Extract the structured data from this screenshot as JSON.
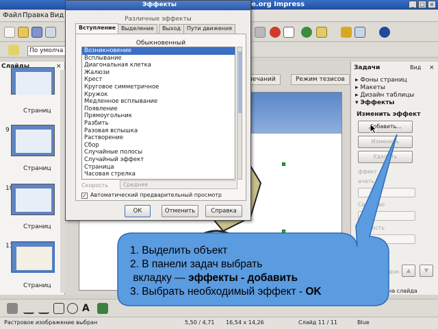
{
  "window": {
    "title": "ffice.org Impress",
    "controls": [
      "_",
      "□",
      "×"
    ]
  },
  "menu": [
    "Файл",
    "Правка",
    "Вид"
  ],
  "toolbar2": {
    "style_value": "По умолча"
  },
  "slides_pane": {
    "title": "Слайды",
    "close": "×",
    "slides": [
      {
        "number": "",
        "label": "Страниц"
      },
      {
        "number": "9",
        "label": "Страниц"
      },
      {
        "number": "10",
        "label": "Страниц"
      },
      {
        "number": "11",
        "label": "Страниц"
      }
    ]
  },
  "editor": {
    "tabs": [
      "мечаний",
      "Режим тезисов"
    ]
  },
  "tasks_pane": {
    "title": "Задачи",
    "view_label": "Вид",
    "close": "×",
    "items": [
      {
        "arrow": "▸",
        "label": "Фоны страниц"
      },
      {
        "arrow": "▸",
        "label": "Макеты"
      },
      {
        "arrow": "▸",
        "label": "Дизайн таблицы"
      },
      {
        "arrow": "▾",
        "label": "Эффекты"
      }
    ],
    "change_effect": "Изменить эффект",
    "add_button": "Добавить...",
    "change_button": "Изменить",
    "delete_button": "Удалить",
    "effect_label": "ффект",
    "start_label": "ачать",
    "property_label": "Свойство",
    "speed_label": "Скорость",
    "order_label": "орядок:",
    "slide_label": "на слайда"
  },
  "dialog": {
    "title": "Эффекты",
    "heading": "Различные эффекты",
    "tabs": [
      "Вступление",
      "Выделение",
      "Выход",
      "Пути движения"
    ],
    "group": "Обыкновенный",
    "effects": [
      "Возникновение",
      "Всплывание",
      "Диагональная клетка",
      "Жалюзи",
      "Крест",
      "Круговое симметричное",
      "Кружок",
      "Медленное всплывание",
      "Появление",
      "Прямоугольник",
      "Разбить",
      "Разовая вспышка",
      "Растворение",
      "Сбор",
      "Случайные полосы",
      "Случайный эффект",
      "Страница",
      "Часовая стрелка"
    ],
    "speed_label": "Скорость",
    "speed_value": "Средняя",
    "auto_preview": "Автоматический предварительный просмотр",
    "ok": "ОК",
    "change": "Отменить",
    "help": "Справка"
  },
  "statusbar": {
    "info": "Растровое изображение выбран",
    "position": "5,50 / 4,71",
    "size": "16,54 x 14,26",
    "slide": "Слайд 11 / 11",
    "theme": "Blue"
  },
  "callout": {
    "line1": "1. Выделить объект",
    "line2": "2. В панели задач выбрать",
    "line3_prefix": "вкладку — ",
    "line3_bold": "эффекты - добавить",
    "line4_prefix": "3. Выбрать необходимый эффект - ",
    "line4_bold": "OK"
  },
  "colors": {
    "titlebar": "#2a5aa8",
    "selection": "#3d6fc4",
    "callout_fill": "#5b9be0",
    "handle": "#22c022"
  }
}
